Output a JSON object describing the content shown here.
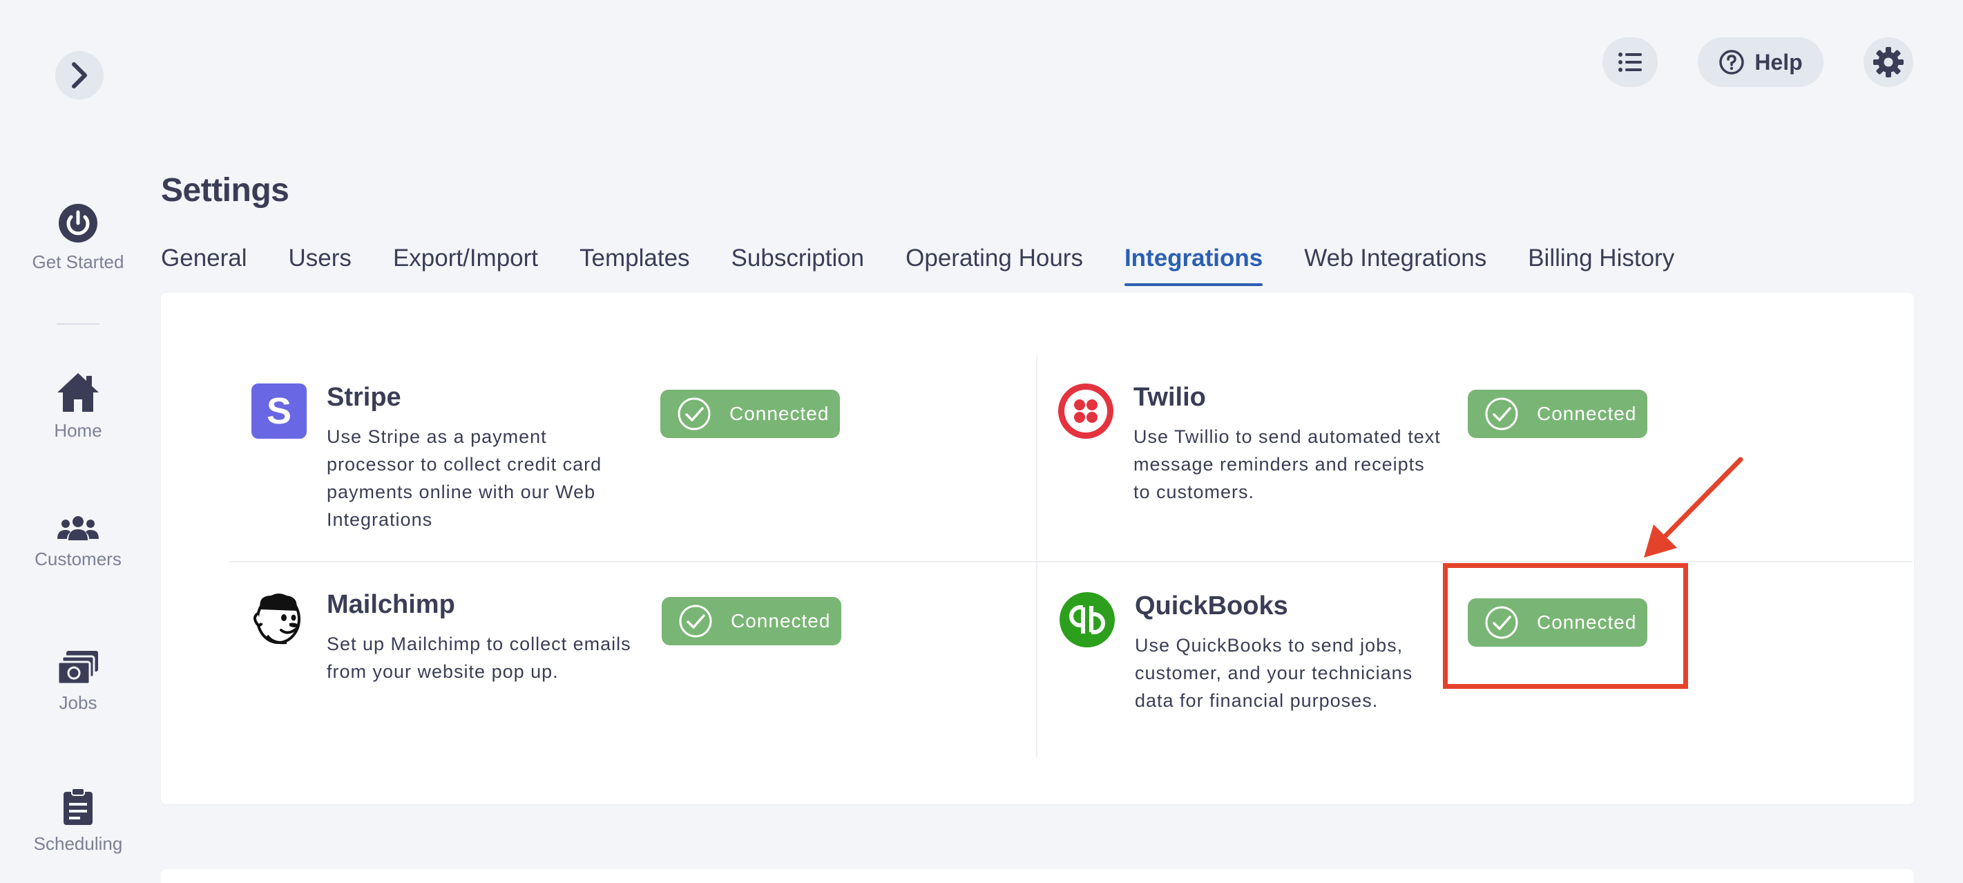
{
  "colors": {
    "accent": "#2b5fb3",
    "connected_green": "#79b574",
    "annotation_red": "#e4432b",
    "stripe_purple": "#6a67e4",
    "twilio_red": "#e4333f",
    "quickbooks_green": "#2ca01c"
  },
  "sidebar": {
    "collapse_icon": "chevron-right-icon",
    "items": [
      {
        "label": "Get Started",
        "icon": "power-icon"
      },
      {
        "label": "Home",
        "icon": "home-icon"
      },
      {
        "label": "Customers",
        "icon": "users-icon"
      },
      {
        "label": "Jobs",
        "icon": "money-icon"
      },
      {
        "label": "Scheduling",
        "icon": "clipboard-icon"
      }
    ]
  },
  "header": {
    "list_icon": "list-icon",
    "help_label": "Help",
    "help_icon": "question-circle-icon",
    "settings_icon": "gear-icon"
  },
  "page": {
    "title": "Settings"
  },
  "tabs": [
    {
      "label": "General",
      "active": false
    },
    {
      "label": "Users",
      "active": false
    },
    {
      "label": "Export/Import",
      "active": false
    },
    {
      "label": "Templates",
      "active": false
    },
    {
      "label": "Subscription",
      "active": false
    },
    {
      "label": "Operating Hours",
      "active": false
    },
    {
      "label": "Integrations",
      "active": true
    },
    {
      "label": "Web Integrations",
      "active": false
    },
    {
      "label": "Billing History",
      "active": false
    }
  ],
  "integrations": [
    {
      "name": "Stripe",
      "icon": "stripe-logo-icon",
      "description": "Use Stripe as a payment processor to collect credit card payments online with our Web Integrations",
      "status": "Connected"
    },
    {
      "name": "Twilio",
      "icon": "twilio-logo-icon",
      "description": "Use Twillio to send automated text message reminders and receipts to customers.",
      "status": "Connected"
    },
    {
      "name": "Mailchimp",
      "icon": "mailchimp-logo-icon",
      "description": "Set up Mailchimp to collect emails from your website pop up.",
      "status": "Connected"
    },
    {
      "name": "QuickBooks",
      "icon": "quickbooks-logo-icon",
      "description": "Use QuickBooks to send jobs, customer, and your technicians data for financial purposes.",
      "status": "Connected"
    }
  ]
}
